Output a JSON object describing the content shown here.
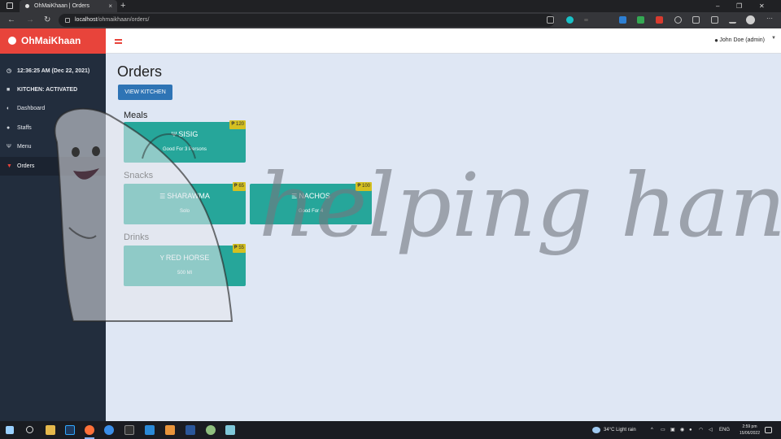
{
  "browser": {
    "tab_title": "OhMaiKhaan | Orders",
    "tab_close": "×",
    "new_tab": "+",
    "url_host": "localhost",
    "url_path": "/ohmaikhaan/orders/",
    "back": "←",
    "forward": "→",
    "reload": "↻",
    "min": "–",
    "restore": "❐",
    "close": "✕",
    "more": "···"
  },
  "colors": {
    "brand": "#e8443b",
    "sidebar_bg": "#222d3d",
    "card": "#26a69a",
    "price_badge": "#d4c021",
    "button": "#2e74b5",
    "page_bg": "#dfe7f4"
  },
  "sidebar": {
    "brand": "OhMaiKhaan",
    "clock": "12:36:25 AM (Dec 22, 2021)",
    "kitchen_status": "KITCHEN: ACTIVATED",
    "items": [
      {
        "label": "Dashboard",
        "icon": "dashboard-icon"
      },
      {
        "label": "Staffs",
        "icon": "user-icon"
      },
      {
        "label": "Menu",
        "icon": "utensils-icon"
      },
      {
        "label": "Orders",
        "icon": "cart-icon"
      }
    ]
  },
  "header": {
    "user": "John Doe (admin)"
  },
  "main": {
    "title": "Orders",
    "view_kitchen": "VIEW KITCHEN",
    "sections": [
      {
        "name": "Meals",
        "items": [
          {
            "name": "SISIG",
            "desc": "Good For 3 Persons",
            "price": "₱ 120",
            "icon": "utensils-icon"
          }
        ]
      },
      {
        "name": "Snacks",
        "items": [
          {
            "name": "SHARAWMA",
            "desc": "Solo",
            "price": "₱ 65",
            "icon": "burger-icon"
          },
          {
            "name": "NACHOS",
            "desc": "Good For 4",
            "price": "₱ 100",
            "icon": "burger-icon"
          }
        ]
      },
      {
        "name": "Drinks",
        "items": [
          {
            "name": "RED HORSE",
            "desc": "500 Ml",
            "price": "₱ 55",
            "icon": "cocktail-icon"
          }
        ]
      }
    ]
  },
  "watermark": {
    "text": "helping hand"
  },
  "taskbar": {
    "weather": "34°C  Light rain",
    "lang": "ENG",
    "time": "2:59 pm",
    "date": "15/06/2022"
  }
}
